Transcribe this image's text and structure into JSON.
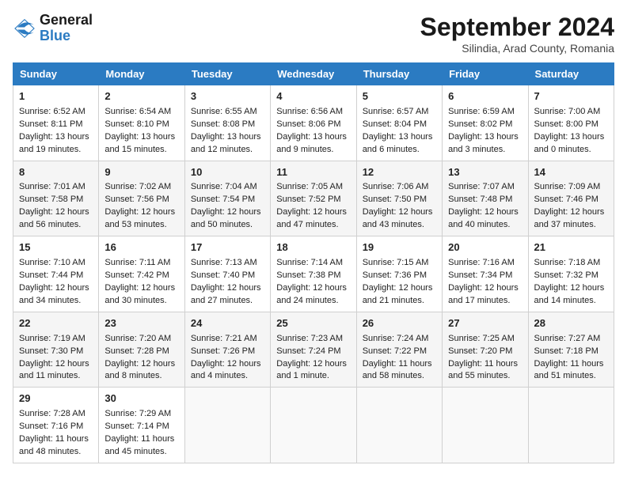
{
  "header": {
    "logo_line1": "General",
    "logo_line2": "Blue",
    "month": "September 2024",
    "location": "Silindia, Arad County, Romania"
  },
  "weekdays": [
    "Sunday",
    "Monday",
    "Tuesday",
    "Wednesday",
    "Thursday",
    "Friday",
    "Saturday"
  ],
  "weeks": [
    [
      {
        "day": "1",
        "lines": [
          "Sunrise: 6:52 AM",
          "Sunset: 8:11 PM",
          "Daylight: 13 hours",
          "and 19 minutes."
        ]
      },
      {
        "day": "2",
        "lines": [
          "Sunrise: 6:54 AM",
          "Sunset: 8:10 PM",
          "Daylight: 13 hours",
          "and 15 minutes."
        ]
      },
      {
        "day": "3",
        "lines": [
          "Sunrise: 6:55 AM",
          "Sunset: 8:08 PM",
          "Daylight: 13 hours",
          "and 12 minutes."
        ]
      },
      {
        "day": "4",
        "lines": [
          "Sunrise: 6:56 AM",
          "Sunset: 8:06 PM",
          "Daylight: 13 hours",
          "and 9 minutes."
        ]
      },
      {
        "day": "5",
        "lines": [
          "Sunrise: 6:57 AM",
          "Sunset: 8:04 PM",
          "Daylight: 13 hours",
          "and 6 minutes."
        ]
      },
      {
        "day": "6",
        "lines": [
          "Sunrise: 6:59 AM",
          "Sunset: 8:02 PM",
          "Daylight: 13 hours",
          "and 3 minutes."
        ]
      },
      {
        "day": "7",
        "lines": [
          "Sunrise: 7:00 AM",
          "Sunset: 8:00 PM",
          "Daylight: 13 hours",
          "and 0 minutes."
        ]
      }
    ],
    [
      {
        "day": "8",
        "lines": [
          "Sunrise: 7:01 AM",
          "Sunset: 7:58 PM",
          "Daylight: 12 hours",
          "and 56 minutes."
        ]
      },
      {
        "day": "9",
        "lines": [
          "Sunrise: 7:02 AM",
          "Sunset: 7:56 PM",
          "Daylight: 12 hours",
          "and 53 minutes."
        ]
      },
      {
        "day": "10",
        "lines": [
          "Sunrise: 7:04 AM",
          "Sunset: 7:54 PM",
          "Daylight: 12 hours",
          "and 50 minutes."
        ]
      },
      {
        "day": "11",
        "lines": [
          "Sunrise: 7:05 AM",
          "Sunset: 7:52 PM",
          "Daylight: 12 hours",
          "and 47 minutes."
        ]
      },
      {
        "day": "12",
        "lines": [
          "Sunrise: 7:06 AM",
          "Sunset: 7:50 PM",
          "Daylight: 12 hours",
          "and 43 minutes."
        ]
      },
      {
        "day": "13",
        "lines": [
          "Sunrise: 7:07 AM",
          "Sunset: 7:48 PM",
          "Daylight: 12 hours",
          "and 40 minutes."
        ]
      },
      {
        "day": "14",
        "lines": [
          "Sunrise: 7:09 AM",
          "Sunset: 7:46 PM",
          "Daylight: 12 hours",
          "and 37 minutes."
        ]
      }
    ],
    [
      {
        "day": "15",
        "lines": [
          "Sunrise: 7:10 AM",
          "Sunset: 7:44 PM",
          "Daylight: 12 hours",
          "and 34 minutes."
        ]
      },
      {
        "day": "16",
        "lines": [
          "Sunrise: 7:11 AM",
          "Sunset: 7:42 PM",
          "Daylight: 12 hours",
          "and 30 minutes."
        ]
      },
      {
        "day": "17",
        "lines": [
          "Sunrise: 7:13 AM",
          "Sunset: 7:40 PM",
          "Daylight: 12 hours",
          "and 27 minutes."
        ]
      },
      {
        "day": "18",
        "lines": [
          "Sunrise: 7:14 AM",
          "Sunset: 7:38 PM",
          "Daylight: 12 hours",
          "and 24 minutes."
        ]
      },
      {
        "day": "19",
        "lines": [
          "Sunrise: 7:15 AM",
          "Sunset: 7:36 PM",
          "Daylight: 12 hours",
          "and 21 minutes."
        ]
      },
      {
        "day": "20",
        "lines": [
          "Sunrise: 7:16 AM",
          "Sunset: 7:34 PM",
          "Daylight: 12 hours",
          "and 17 minutes."
        ]
      },
      {
        "day": "21",
        "lines": [
          "Sunrise: 7:18 AM",
          "Sunset: 7:32 PM",
          "Daylight: 12 hours",
          "and 14 minutes."
        ]
      }
    ],
    [
      {
        "day": "22",
        "lines": [
          "Sunrise: 7:19 AM",
          "Sunset: 7:30 PM",
          "Daylight: 12 hours",
          "and 11 minutes."
        ]
      },
      {
        "day": "23",
        "lines": [
          "Sunrise: 7:20 AM",
          "Sunset: 7:28 PM",
          "Daylight: 12 hours",
          "and 8 minutes."
        ]
      },
      {
        "day": "24",
        "lines": [
          "Sunrise: 7:21 AM",
          "Sunset: 7:26 PM",
          "Daylight: 12 hours",
          "and 4 minutes."
        ]
      },
      {
        "day": "25",
        "lines": [
          "Sunrise: 7:23 AM",
          "Sunset: 7:24 PM",
          "Daylight: 12 hours",
          "and 1 minute."
        ]
      },
      {
        "day": "26",
        "lines": [
          "Sunrise: 7:24 AM",
          "Sunset: 7:22 PM",
          "Daylight: 11 hours",
          "and 58 minutes."
        ]
      },
      {
        "day": "27",
        "lines": [
          "Sunrise: 7:25 AM",
          "Sunset: 7:20 PM",
          "Daylight: 11 hours",
          "and 55 minutes."
        ]
      },
      {
        "day": "28",
        "lines": [
          "Sunrise: 7:27 AM",
          "Sunset: 7:18 PM",
          "Daylight: 11 hours",
          "and 51 minutes."
        ]
      }
    ],
    [
      {
        "day": "29",
        "lines": [
          "Sunrise: 7:28 AM",
          "Sunset: 7:16 PM",
          "Daylight: 11 hours",
          "and 48 minutes."
        ]
      },
      {
        "day": "30",
        "lines": [
          "Sunrise: 7:29 AM",
          "Sunset: 7:14 PM",
          "Daylight: 11 hours",
          "and 45 minutes."
        ]
      },
      {
        "day": "",
        "lines": []
      },
      {
        "day": "",
        "lines": []
      },
      {
        "day": "",
        "lines": []
      },
      {
        "day": "",
        "lines": []
      },
      {
        "day": "",
        "lines": []
      }
    ]
  ]
}
